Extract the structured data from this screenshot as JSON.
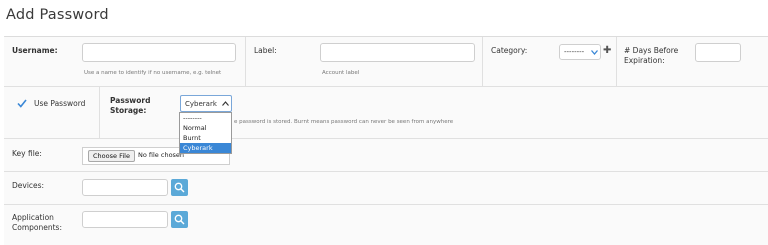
{
  "page": {
    "title": "Add Password"
  },
  "username": {
    "label": "Username:",
    "value": "",
    "hint": "Use a name to identify if no username, e.g. telnet"
  },
  "label_field": {
    "label": "Label:",
    "value": "",
    "hint": "Account label"
  },
  "category": {
    "label": "Category:",
    "selected": "--------"
  },
  "expiration": {
    "label_line1": "# Days Before",
    "label_line2": "Expiration:",
    "value": ""
  },
  "use_password": {
    "label": "Use Password",
    "checked": true
  },
  "password_storage": {
    "label_line1": "Password",
    "label_line2": "Storage:",
    "selected": "Cyberark",
    "hint": "e password is stored. Burnt means password can never be seen from anywhere",
    "options": [
      "--------",
      "Normal",
      "Burnt",
      "Cyberark"
    ]
  },
  "key_file": {
    "label": "Key file:",
    "button_label": "Choose File",
    "status": "No file chosen"
  },
  "devices": {
    "label": "Devices:",
    "value": ""
  },
  "application_components": {
    "label_line1": "Application",
    "label_line2": "Components:",
    "value": ""
  },
  "colors": {
    "accent": "#3a87d6",
    "search_button": "#5ba9d8",
    "checkmark": "#3a87d6"
  }
}
